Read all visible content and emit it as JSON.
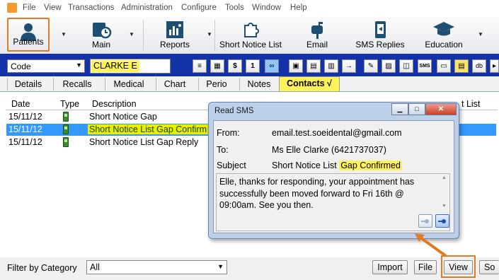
{
  "menu": [
    "File",
    "View",
    "Transactions",
    "Administration",
    "Configure",
    "Tools",
    "Window",
    "Help"
  ],
  "toolbar": {
    "patients": "Patients",
    "main": "Main",
    "reports": "Reports",
    "short_notice": "Short Notice List",
    "email": "Email",
    "sms_replies": "SMS Replies",
    "education": "Education"
  },
  "patient_bar": {
    "code_select": "Code",
    "patient_name": "CLARKE E",
    "small_buttons": [
      "$",
      "1",
      "SMS",
      "db"
    ]
  },
  "tabs": [
    "Details",
    "Recalls",
    "Medical",
    "Chart",
    "Perio",
    "Notes",
    "Contacts"
  ],
  "active_tab": "Contacts",
  "active_tab_mark": "√",
  "list": {
    "columns": {
      "date": "Date",
      "type": "Type",
      "description": "Description",
      "last": "t List"
    },
    "rows": [
      {
        "date": "15/11/12",
        "description": "Short Notice Gap"
      },
      {
        "date": "15/11/12",
        "description": "Short Notice List Gap Confirm"
      },
      {
        "date": "15/11/12",
        "description": "Short Notice List Gap Reply"
      }
    ]
  },
  "bottom": {
    "filter_label": "Filter by Category",
    "filter_value": "All",
    "import": "Import",
    "file": "File",
    "view": "View",
    "sort": "So"
  },
  "dialog": {
    "title": "Read SMS",
    "from_label": "From:",
    "from_value": "email.test.soeidental@gmail.com",
    "to_label": "To:",
    "to_value": "Ms Elle Clarke (6421737037)",
    "subject_label": "Subject",
    "subject_prefix": "Short Notice List ",
    "subject_highlight": "Gap Confirmed",
    "message": "Elle, thanks for responding, your appointment has successfully been moved forward to Fri 16th @ 09:00am. See you then."
  },
  "colors": {
    "highlight_orange": "#e07b24",
    "patient_bar_blue": "#1432a8",
    "selection_blue": "#3399ff",
    "yellow_highlight": "#fff35c"
  }
}
